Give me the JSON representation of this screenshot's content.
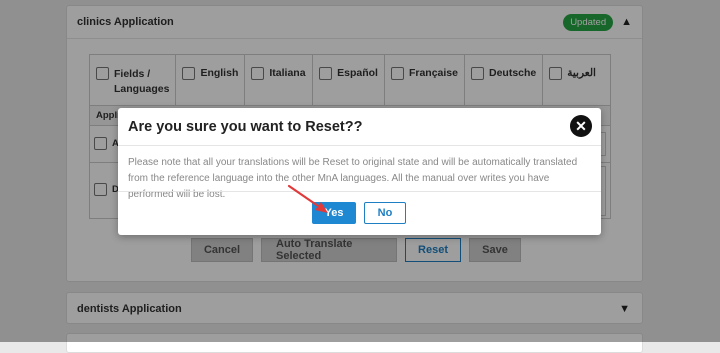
{
  "clinics": {
    "title": "clinics Application",
    "badge": "Updated",
    "chevron": "chevron-up-icon",
    "columns": [
      "Fields / Languages",
      "English",
      "Italiana",
      "Español",
      "Française",
      "Deutsche",
      "العربية"
    ],
    "subheader": "Applic",
    "row1_label": "Al",
    "row2_label": "De",
    "actions": {
      "cancel": "Cancel",
      "auto_translate": "Auto Translate Selected",
      "reset": "Reset",
      "save": "Save"
    }
  },
  "dentists": {
    "title": "dentists Application",
    "chevron": "chevron-down-icon"
  },
  "modal": {
    "title": "Are you sure you want to Reset??",
    "close_icon": "close-circle-icon",
    "body": "Please note that all your translations will be Reset to original state and will be automatically translated from the reference language into the other MnA languages. All the manual over writes you have performed will be lost.",
    "yes": "Yes",
    "no": "No"
  },
  "colors": {
    "badge_green": "#28a745",
    "primary_blue": "#1e88d3",
    "annotation_arrow": "#e03a3a"
  }
}
